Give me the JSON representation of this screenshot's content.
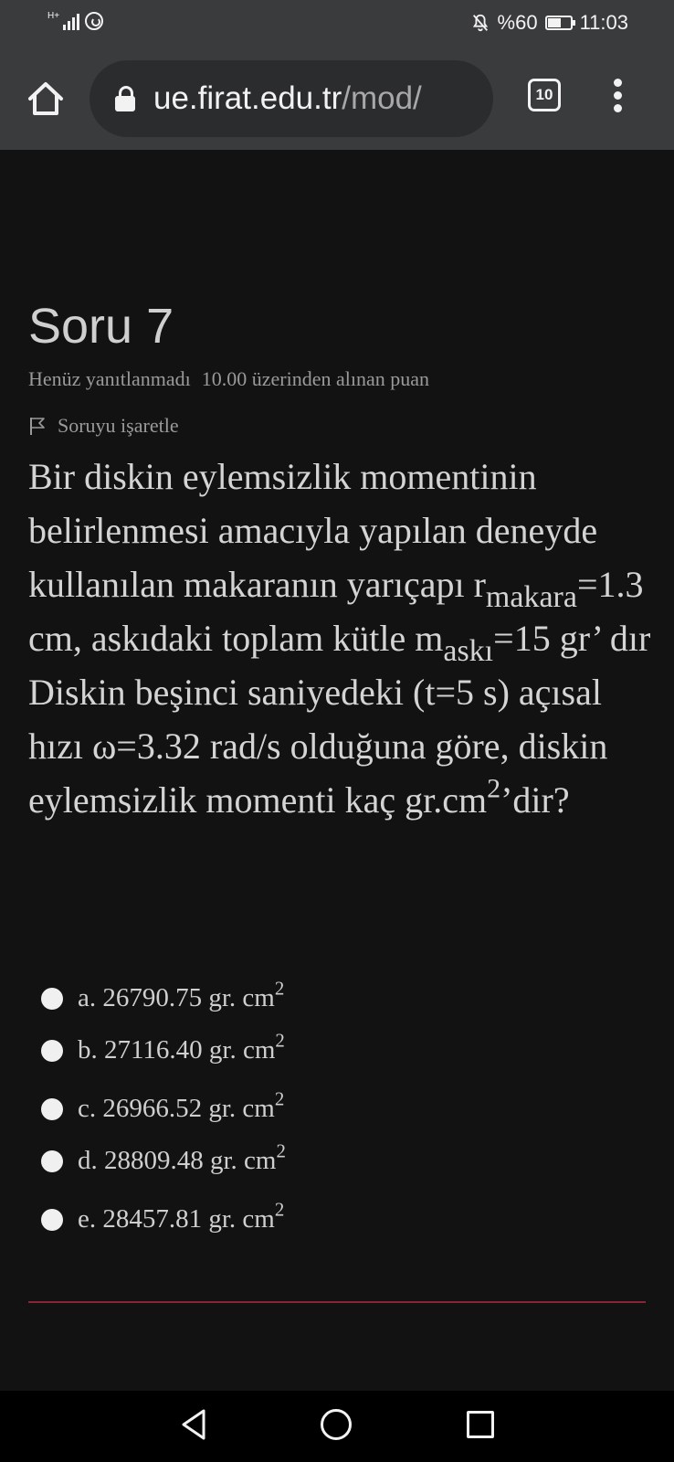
{
  "status_bar": {
    "network": "H+",
    "battery": "%60",
    "battery_level": 0.6,
    "time": "11:03",
    "icons": [
      "signal-icon",
      "whatsapp-icon",
      "bell-off-icon",
      "battery-icon"
    ]
  },
  "browser": {
    "url_host": "ue.firat.edu.tr",
    "url_path": "/mod/",
    "tab_count": "10",
    "icons": [
      "home-icon",
      "lock-icon",
      "more-vert-icon"
    ]
  },
  "question": {
    "title": "Soru 7",
    "status": "Henüz yanıtlanmadı",
    "points": "10.00 üzerinden alınan puan",
    "flag_label": "Soruyu işaretle",
    "text": {
      "p1": "Bir diskin eylemsizlik momentinin belirlenmesi amacıyla yapılan deneyde kullanılan makaranın yarıçapı r",
      "sub1": "makara",
      "p2": "=1.3 cm, askıdaki toplam kütle m",
      "sub2": "askı",
      "p3": "=15 gr’ dır Diskin beşinci saniyedeki (t=5 s) açısal hızı ω=3.32 rad/s olduğuna göre, diskin eylemsizlik momenti kaç gr.cm",
      "sup": "2",
      "p4": "’dir?"
    },
    "answers": [
      {
        "text": "a. 26790.75 gr. cm",
        "sup": "2"
      },
      {
        "text": "b. 27116.40 gr. cm",
        "sup": "2"
      },
      {
        "text": "c. 26966.52 gr. cm",
        "sup": "2"
      },
      {
        "text": "d. 28809.48 gr. cm",
        "sup": "2"
      },
      {
        "text": "e. 28457.81 gr. cm",
        "sup": "2"
      }
    ]
  },
  "navigation": {
    "icons": [
      "back-icon",
      "home-circle-icon",
      "recent-apps-icon"
    ]
  },
  "colors": {
    "toolbar": "#3a3b3d",
    "background": "#121212",
    "divider": "#8a2436"
  }
}
